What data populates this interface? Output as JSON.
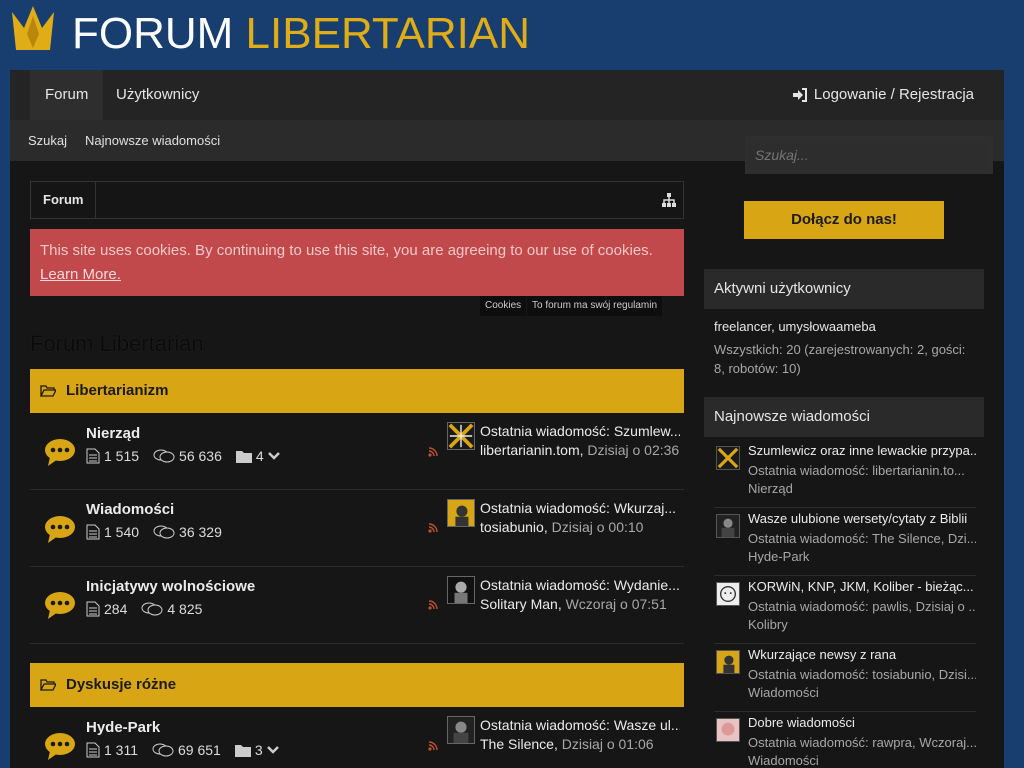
{
  "brand": {
    "word1": "FORUM",
    "word2": "LIBERTARIAN",
    "colors": {
      "accent": "#d8a514",
      "header_bg": "#173e6e",
      "cookie_bg": "#c2494b"
    }
  },
  "nav": {
    "tabs": [
      {
        "label": "Forum"
      },
      {
        "label": "Użytkownicy"
      }
    ],
    "login": "Logowanie / Rejestracja",
    "sub": [
      {
        "label": "Szukaj"
      },
      {
        "label": "Najnowsze wiadomości"
      }
    ]
  },
  "search": {
    "placeholder": "Szukaj..."
  },
  "breadcrumb": {
    "item": "Forum"
  },
  "cookie": {
    "text": "This site uses cookies. By continuing to use this site, you are agreeing to our use of cookies.",
    "learn_more": "Learn More.",
    "tooltips": [
      "Cookies",
      "To forum ma swój regulamin"
    ]
  },
  "page_title": "Forum Libertarian",
  "categories": [
    {
      "title": "Libertarianizm",
      "nodes": [
        {
          "title": "Nierząd",
          "threads": "1 515",
          "messages": "56 636",
          "subforums": "4",
          "last_title": "Ostatnia wiadomość: Szumlew...",
          "last_user": "libertarianin.tom",
          "last_date": "Dzisiaj o 02:36"
        },
        {
          "title": "Wiadomości",
          "threads": "1 540",
          "messages": "36 329",
          "last_title": "Ostatnia wiadomość: Wkurzaj...",
          "last_user": "tosiabunio",
          "last_date": "Dzisiaj o 00:10"
        },
        {
          "title": "Inicjatywy wolnościowe",
          "threads": "284",
          "messages": "4 825",
          "last_title": "Ostatnia wiadomość: Wydanie...",
          "last_user": "Solitary Man",
          "last_date": "Wczoraj o 07:51"
        }
      ]
    },
    {
      "title": "Dyskusje różne",
      "nodes": [
        {
          "title": "Hyde-Park",
          "threads": "1 311",
          "messages": "69 651",
          "subforums": "3",
          "last_title": "Ostatnia wiadomość: Wasze ul...",
          "last_user": "The Silence",
          "last_date": "Dzisiaj o 01:06"
        }
      ]
    }
  ],
  "sidebar": {
    "join": "Dołącz do nas!",
    "online_title": "Aktywni użytkownicy",
    "online_users": "freelancer, umysłowaameba",
    "online_stats": "Wszystkich: 20 (zarejestrowanych: 2, gości: 8, robotów: 10)",
    "latest_title": "Najnowsze wiadomości",
    "posts": [
      {
        "title": "Szumlewicz oraz inne lewackie przypa...",
        "last": "Ostatnia wiadomość: libertarianin.to...",
        "forum": "Nierząd"
      },
      {
        "title": "Wasze ulubione wersety/cytaty z Biblii",
        "last": "Ostatnia wiadomość: The Silence, Dzi...",
        "forum": "Hyde-Park"
      },
      {
        "title": "KORWiN, KNP, JKM, Koliber - bieżąc...",
        "last": "Ostatnia wiadomość: pawlis, Dzisiaj o ...",
        "forum": "Kolibry"
      },
      {
        "title": "Wkurzające newsy z rana",
        "last": "Ostatnia wiadomość: tosiabunio, Dzisi...",
        "forum": "Wiadomości"
      },
      {
        "title": "Dobre wiadomości",
        "last": "Ostatnia wiadomość: rawpra, Wczoraj...",
        "forum": "Wiadomości"
      }
    ]
  }
}
